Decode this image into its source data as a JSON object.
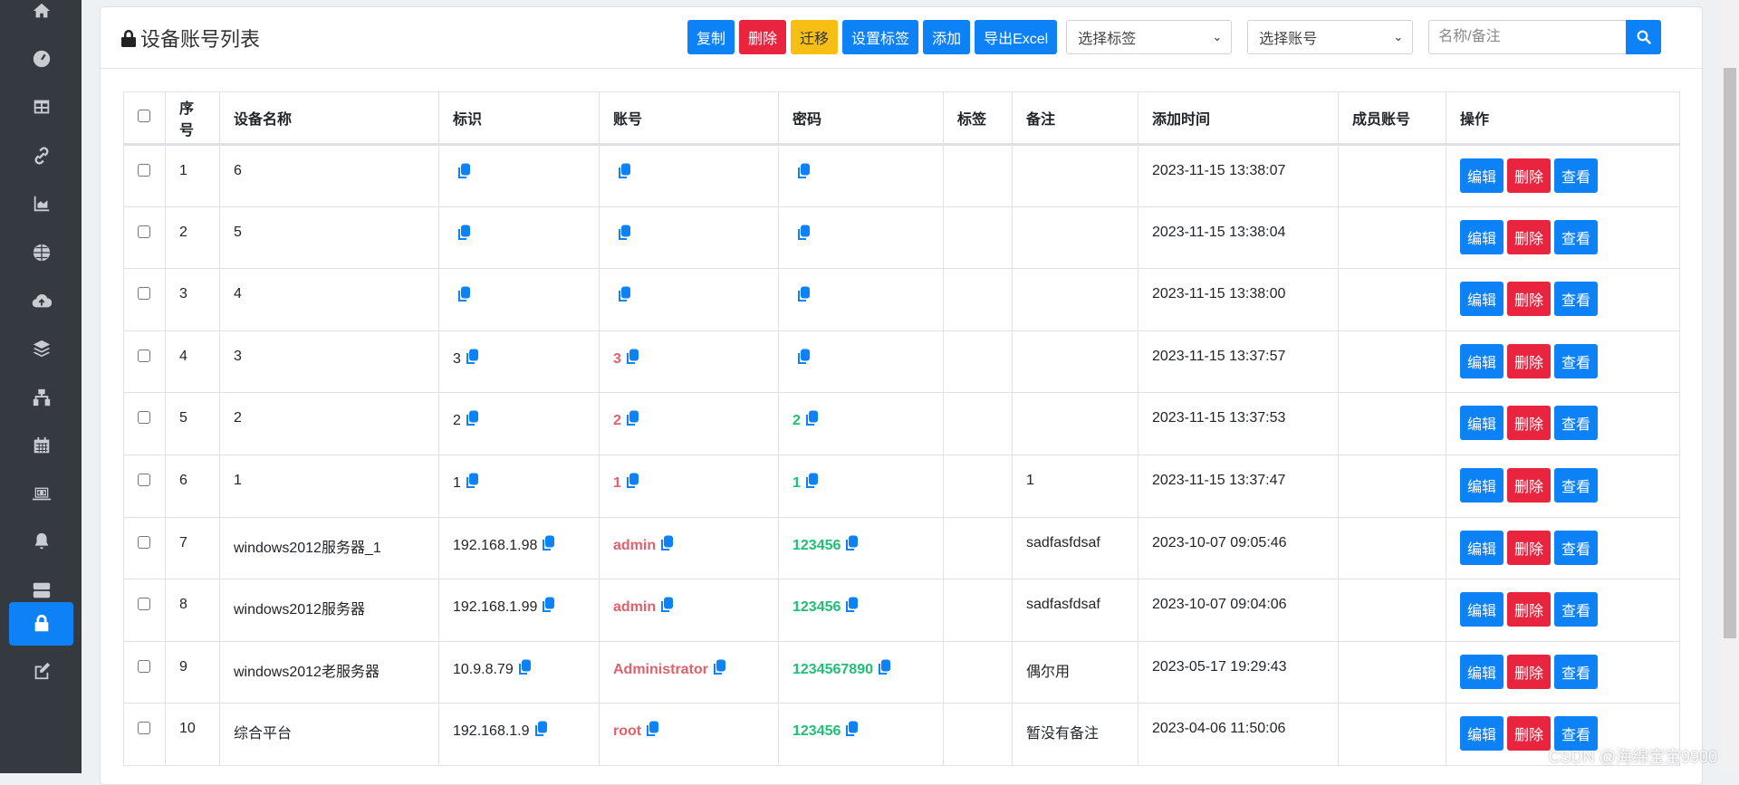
{
  "sidebar": {
    "icons": [
      "home-icon",
      "dashboard-icon",
      "table-icon",
      "link-icon",
      "chart-area-icon",
      "globe-icon",
      "cloud-upload-icon",
      "layers-icon",
      "network-icon",
      "calendar-icon",
      "laptop-code-icon",
      "bell-icon",
      "server-icon",
      "lock-icon",
      "edit-icon"
    ],
    "active": "lock-icon"
  },
  "header": {
    "title": "设备账号列表",
    "buttons": {
      "copy": "复制",
      "delete": "删除",
      "migrate": "迁移",
      "set_tag": "设置标签",
      "add": "添加",
      "export": "导出Excel"
    },
    "tag_select": "选择标签",
    "account_select": "选择账号",
    "search_placeholder": "名称/备注"
  },
  "table": {
    "columns": [
      "序号",
      "设备名称",
      "标识",
      "账号",
      "密码",
      "标签",
      "备注",
      "添加时间",
      "成员账号",
      "操作"
    ],
    "actions": {
      "edit": "编辑",
      "delete": "删除",
      "view": "查看"
    },
    "rows": [
      {
        "no": "1",
        "name": "6",
        "ident": "",
        "account": "",
        "password": "",
        "tag": "",
        "note": "",
        "time": "2023-11-15 13:38:07",
        "member": ""
      },
      {
        "no": "2",
        "name": "5",
        "ident": "",
        "account": "",
        "password": "",
        "tag": "",
        "note": "",
        "time": "2023-11-15 13:38:04",
        "member": ""
      },
      {
        "no": "3",
        "name": "4",
        "ident": "",
        "account": "",
        "password": "",
        "tag": "",
        "note": "",
        "time": "2023-11-15 13:38:00",
        "member": ""
      },
      {
        "no": "4",
        "name": "3",
        "ident": "3",
        "account": "3",
        "password": "",
        "tag": "",
        "note": "",
        "time": "2023-11-15 13:37:57",
        "member": ""
      },
      {
        "no": "5",
        "name": "2",
        "ident": "2",
        "account": "2",
        "password": "2",
        "tag": "",
        "note": "",
        "time": "2023-11-15 13:37:53",
        "member": ""
      },
      {
        "no": "6",
        "name": "1",
        "ident": "1",
        "account": "1",
        "password": "1",
        "tag": "",
        "note": "1",
        "time": "2023-11-15 13:37:47",
        "member": ""
      },
      {
        "no": "7",
        "name": "windows2012服务器_1",
        "ident": "192.168.1.98",
        "account": "admin",
        "password": "123456",
        "tag": "",
        "note": "sadfasfdsaf",
        "time": "2023-10-07 09:05:46",
        "member": ""
      },
      {
        "no": "8",
        "name": "windows2012服务器",
        "ident": "192.168.1.99",
        "account": "admin",
        "password": "123456",
        "tag": "",
        "note": "sadfasfdsaf",
        "time": "2023-10-07 09:04:06",
        "member": ""
      },
      {
        "no": "9",
        "name": "windows2012老服务器",
        "ident": "10.9.8.79",
        "account": "Administrator",
        "password": "1234567890",
        "tag": "",
        "note": "偶尔用",
        "time": "2023-05-17 19:29:43",
        "member": ""
      },
      {
        "no": "10",
        "name": "综合平台",
        "ident": "192.168.1.9",
        "account": "root",
        "password": "123456",
        "tag": "",
        "note": "暂没有备注",
        "time": "2023-04-06 11:50:06",
        "member": ""
      }
    ]
  },
  "watermark": "CSDN @海绵宝宝9900",
  "colors": {
    "primary": "#0d82f7",
    "danger": "#e8243f",
    "warning": "#f7be13",
    "account": "#e0606b",
    "password": "#1fbf76",
    "sidebar": "#343a40"
  }
}
